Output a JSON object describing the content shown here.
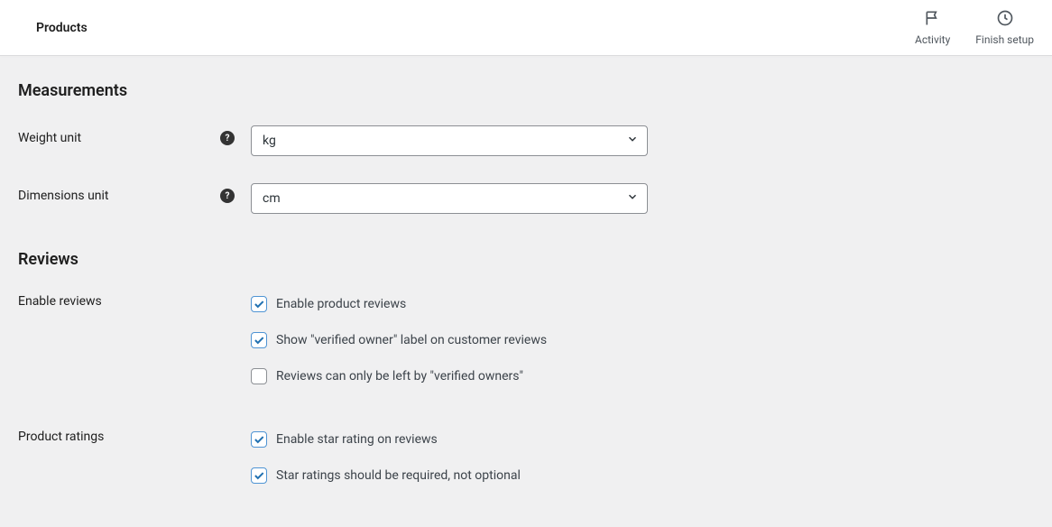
{
  "header": {
    "title": "Products",
    "activity_label": "Activity",
    "finish_setup_label": "Finish setup"
  },
  "sections": {
    "measurements_heading": "Measurements",
    "reviews_heading": "Reviews"
  },
  "measurements": {
    "weight_label": "Weight unit",
    "weight_value": "kg",
    "dimensions_label": "Dimensions unit",
    "dimensions_value": "cm"
  },
  "reviews": {
    "enable_label": "Enable reviews",
    "options": [
      {
        "label": "Enable product reviews",
        "checked": true
      },
      {
        "label": "Show \"verified owner\" label on customer reviews",
        "checked": true
      },
      {
        "label": "Reviews can only be left by \"verified owners\"",
        "checked": false
      }
    ],
    "ratings_label": "Product ratings",
    "ratings_options": [
      {
        "label": "Enable star rating on reviews",
        "checked": true
      },
      {
        "label": "Star ratings should be required, not optional",
        "checked": true
      }
    ]
  }
}
